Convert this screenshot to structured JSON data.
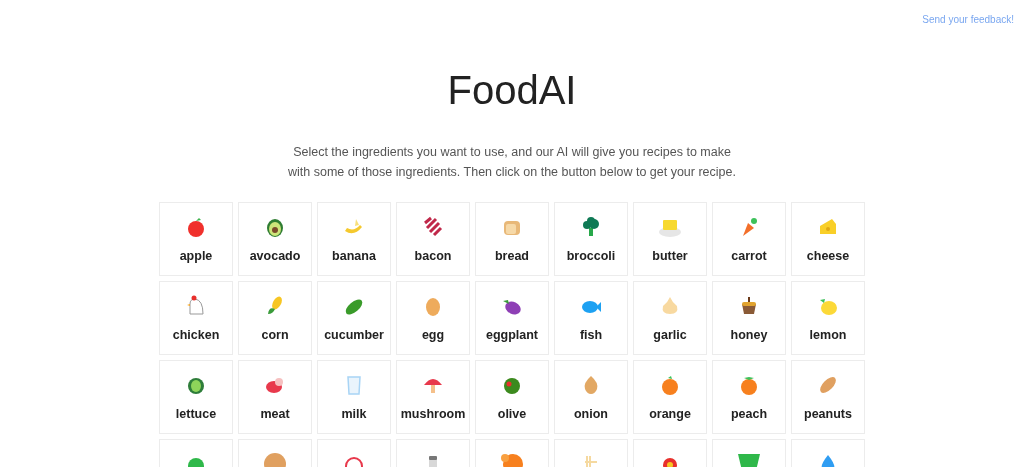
{
  "feedback_link": "Send your feedback!",
  "title": "FoodAI",
  "intro": "Select the ingredients you want to use, and our AI will give you recipes to make with some of those ingredients. Then click on the button below to get your recipe.",
  "ingredients": [
    {
      "kind": "tile",
      "label": "apple"
    },
    {
      "kind": "tile",
      "label": "avocado"
    },
    {
      "kind": "tile",
      "label": "banana"
    },
    {
      "kind": "tile",
      "label": "bacon"
    },
    {
      "kind": "tile",
      "label": "bread"
    },
    {
      "kind": "tile",
      "label": "broccoli"
    },
    {
      "kind": "tile",
      "label": "butter"
    },
    {
      "kind": "tile",
      "label": "carrot"
    },
    {
      "kind": "tile",
      "label": "cheese"
    },
    {
      "kind": "tile",
      "label": "chicken"
    },
    {
      "kind": "tile",
      "label": "corn"
    },
    {
      "kind": "tile",
      "label": "cucumber"
    },
    {
      "kind": "tile",
      "label": "egg"
    },
    {
      "kind": "tile",
      "label": "eggplant"
    },
    {
      "kind": "tile",
      "label": "fish"
    },
    {
      "kind": "tile",
      "label": "garlic"
    },
    {
      "kind": "tile",
      "label": "honey"
    },
    {
      "kind": "tile",
      "label": "lemon"
    },
    {
      "kind": "tile",
      "label": "lettuce"
    },
    {
      "kind": "tile",
      "label": "meat"
    },
    {
      "kind": "tile",
      "label": "milk"
    },
    {
      "kind": "tile",
      "label": "mushroom"
    },
    {
      "kind": "tile",
      "label": "olive"
    },
    {
      "kind": "tile",
      "label": "onion"
    },
    {
      "kind": "tile",
      "label": "orange"
    },
    {
      "kind": "tile",
      "label": "peach"
    },
    {
      "kind": "tile",
      "label": "peanuts"
    },
    {
      "kind": "cut_off"
    },
    {
      "kind": "cut_off"
    },
    {
      "kind": "cut_off"
    },
    {
      "kind": "cut_off"
    },
    {
      "kind": "cut_off"
    },
    {
      "kind": "cut_off"
    },
    {
      "kind": "cut_off"
    },
    {
      "kind": "cut_off"
    },
    {
      "kind": "cut_off"
    }
  ]
}
